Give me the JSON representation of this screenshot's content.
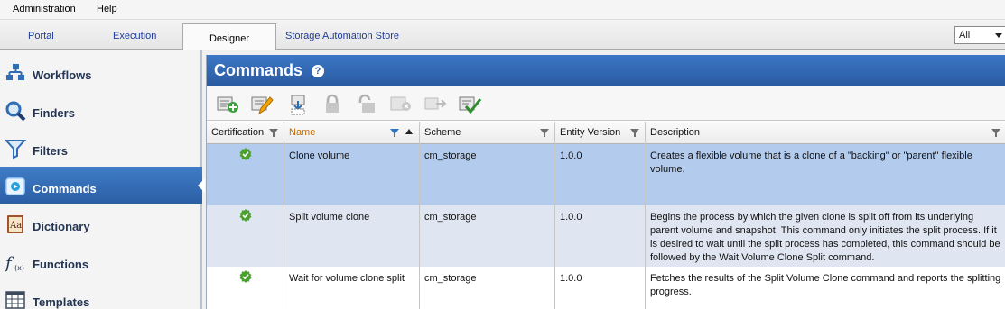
{
  "menu": {
    "administration": "Administration",
    "help": "Help"
  },
  "tabs": [
    {
      "label": "Portal"
    },
    {
      "label": "Execution"
    },
    {
      "label": "Designer"
    },
    {
      "label": "Storage Automation Store"
    }
  ],
  "filter_select": {
    "value": "All"
  },
  "sidebar": {
    "items": [
      {
        "label": "Workflows",
        "icon": "workflows-icon"
      },
      {
        "label": "Finders",
        "icon": "magnifier-icon"
      },
      {
        "label": "Filters",
        "icon": "funnel-icon"
      },
      {
        "label": "Commands",
        "icon": "command-icon",
        "selected": true
      },
      {
        "label": "Dictionary",
        "icon": "dictionary-book-icon"
      },
      {
        "label": "Functions",
        "icon": "function-fx-icon"
      },
      {
        "label": "Templates",
        "icon": "table-grid-icon"
      }
    ]
  },
  "panel": {
    "title": "Commands",
    "help_icon": "?"
  },
  "toolbar": {
    "buttons": [
      "add-command-icon",
      "edit-command-icon",
      "import-command-icon",
      "lock-icon",
      "unlock-icon",
      "delete-command-icon",
      "export-command-icon",
      "certify-command-icon"
    ]
  },
  "table": {
    "columns": [
      "Certification",
      "Name",
      "Scheme",
      "Entity Version",
      "Description"
    ],
    "sorted_column": "Name",
    "rows": [
      {
        "certified": true,
        "name": "Clone volume",
        "scheme": "cm_storage",
        "version": "1.0.0",
        "description": "Creates a flexible volume that is a clone of a \"backing\" or \"parent\" flexible volume."
      },
      {
        "certified": true,
        "name": "Split volume clone",
        "scheme": "cm_storage",
        "version": "1.0.0",
        "description": "Begins the process by which the given clone is split off from its underlying parent volume and snapshot. This command only initiates the split process. If it is desired to wait until the split process has completed, this command should be followed by the Wait Volume Clone Split command."
      },
      {
        "certified": true,
        "name": "Wait for volume clone split",
        "scheme": "cm_storage",
        "version": "1.0.0",
        "description": "Fetches the results of the Split Volume Clone command and reports the splitting progress."
      }
    ]
  },
  "colors": {
    "accent": "#2a5aa0",
    "selected_row": "#b3ccee",
    "certified_green": "#4aa02c"
  }
}
